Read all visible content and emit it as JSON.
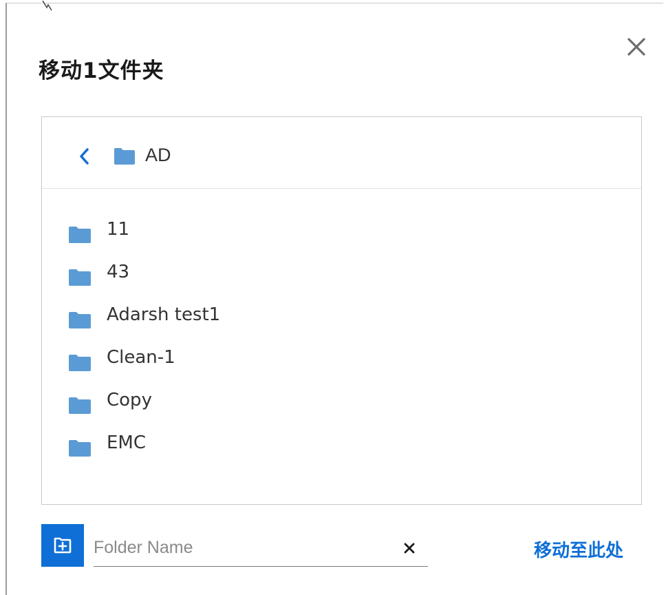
{
  "dialog": {
    "title": "移动1文件夹",
    "close_icon": "close-icon"
  },
  "browser": {
    "back_icon": "chevron-left-icon",
    "current_folder": "AD",
    "folders": [
      {
        "label": "11",
        "icon": "folder-icon"
      },
      {
        "label": "43",
        "icon": "folder-icon"
      },
      {
        "label": "Adarsh test1",
        "icon": "folder-icon"
      },
      {
        "label": "Clean-1",
        "icon": "folder-icon"
      },
      {
        "label": "Copy",
        "icon": "folder-icon"
      },
      {
        "label": "EMC",
        "icon": "folder-icon"
      }
    ]
  },
  "footer": {
    "new_folder_icon": "new-folder-icon",
    "folder_name_value": "",
    "folder_name_placeholder": "Folder Name",
    "clear_icon": "clear-icon",
    "move_here_label": "移动至此处"
  },
  "colors": {
    "accent": "#0f6fd6",
    "folder": "#5b9bd5",
    "text": "#333333"
  }
}
